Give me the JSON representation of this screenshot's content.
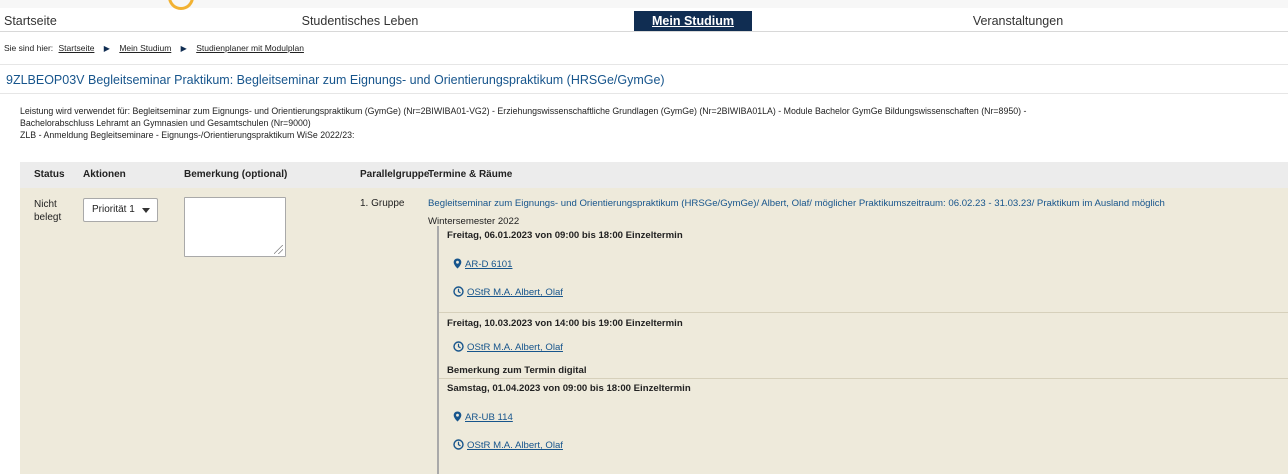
{
  "nav": {
    "items": [
      "Startseite",
      "Studentisches Leben",
      "Mein Studium",
      "Veranstaltungen"
    ]
  },
  "breadcrumb": {
    "prefix": "Sie sind hier:",
    "items": [
      "Startseite",
      "Mein Studium",
      "Studienplaner mit Modulplan"
    ]
  },
  "module": {
    "title": "9ZLBEOP03V Begleitseminar Praktikum: Begleitseminar zum Eignungs- und Orientierungspraktikum (HRSGe/GymGe)"
  },
  "info": {
    "line1": "Leistung wird verwendet für: Begleitseminar zum Eignungs- und Orientierungspraktikum (GymGe) (Nr=2BIWIBA01-VG2) - Erziehungswissenschaftliche Grundlagen (GymGe) (Nr=2BIWIBA01LA) - Module Bachelor GymGe Bildungswissenschaften (Nr=8950) -",
    "line2": "Bachelorabschluss Lehramt an Gymnasien und Gesamtschulen (Nr=9000)",
    "line3": "ZLB - Anmeldung Begleitseminare - Eignungs-/Orientierungspraktikum WiSe 2022/23:"
  },
  "table": {
    "headers": [
      "Status",
      "Aktionen",
      "Bemerkung (optional)",
      "Parallelgruppe",
      "Termine & Räume"
    ],
    "row": {
      "status_line1": "Nicht",
      "status_line2": "belegt",
      "priority": "Priorität 1",
      "group": "1. Gruppe",
      "course_title": "Begleitseminar zum Eignungs- und Orientierungspraktikum (HRSGe/GymGe)/ Albert, Olaf/ möglicher Praktikumszeitraum: 06.02.23 - 31.03.23/ Praktikum im Ausland möglich",
      "semester": "Wintersemester 2022",
      "dates": [
        {
          "when": "Freitag, 06.01.2023 von 09:00 bis 18:00 Einzeltermin",
          "room": "AR-D 6101",
          "lecturer": "OStR M.A. Albert, Olaf"
        },
        {
          "when": "Freitag, 10.03.2023 von 14:00 bis 19:00 Einzeltermin",
          "lecturer": "OStR M.A. Albert, Olaf",
          "note": "Bemerkung zum Termin digital"
        },
        {
          "when": "Samstag, 01.04.2023 von 09:00 bis 18:00 Einzeltermin",
          "room": "AR-UB 114",
          "lecturer": "OStR M.A. Albert, Olaf"
        }
      ]
    }
  },
  "icons": {
    "room": "map-pin-icon",
    "lecturer": "clock-icon",
    "breadcrumb_separator": "chevron-right-icon",
    "dropdown": "caret-down-icon"
  },
  "colors": {
    "nav_active_bg": "#102d52",
    "link": "#17558c",
    "row_bg": "#eeeadb",
    "header_bg": "#ececec",
    "logo_accent": "#f2b233"
  }
}
